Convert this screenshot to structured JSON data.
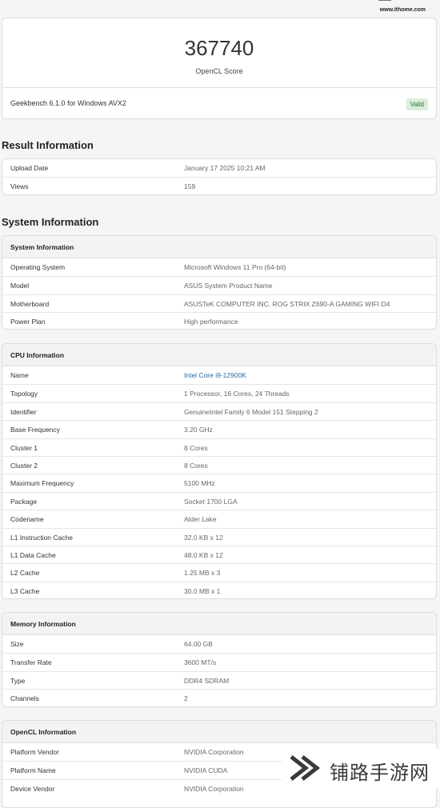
{
  "watermark": {
    "url": "www.ithome.com",
    "brand": "铺路手游网"
  },
  "score": {
    "value": "367740",
    "label": "OpenCL Score",
    "version": "Geekbench 6.1.0 for Windows AVX2",
    "badge": "Valid"
  },
  "result": {
    "title": "Result Information",
    "rows": [
      {
        "k": "Upload Date",
        "v": "January 17 2025 10:21 AM"
      },
      {
        "k": "Views",
        "v": "159"
      }
    ]
  },
  "system": {
    "title": "System Information",
    "sys_header": "System Information",
    "sys_rows": [
      {
        "k": "Operating System",
        "v": "Microsoft Windows 11 Pro (64-bit)"
      },
      {
        "k": "Model",
        "v": "ASUS System Product Name"
      },
      {
        "k": "Motherboard",
        "v": "ASUSTeK COMPUTER INC. ROG STRIX Z690-A GAMING WIFI D4"
      },
      {
        "k": "Power Plan",
        "v": "High performance"
      }
    ],
    "cpu_header": "CPU Information",
    "cpu_rows": [
      {
        "k": "Name",
        "v": "Intel Core i9-12900K"
      },
      {
        "k": "Topology",
        "v": "1 Processor, 16 Cores, 24 Threads"
      },
      {
        "k": "Identifier",
        "v": "GenuineIntel Family 6 Model 151 Stepping 2"
      },
      {
        "k": "Base Frequency",
        "v": "3.20 GHz"
      },
      {
        "k": "Cluster 1",
        "v": "8 Cores"
      },
      {
        "k": "Cluster 2",
        "v": "8 Cores"
      },
      {
        "k": "Maximum Frequency",
        "v": "5100 MHz"
      },
      {
        "k": "Package",
        "v": "Socket 1700 LGA"
      },
      {
        "k": "Codename",
        "v": "Alder Lake"
      },
      {
        "k": "L1 Instruction Cache",
        "v": "32.0 KB x 12"
      },
      {
        "k": "L1 Data Cache",
        "v": "48.0 KB x 12"
      },
      {
        "k": "L2 Cache",
        "v": "1.25 MB x 3"
      },
      {
        "k": "L3 Cache",
        "v": "30.0 MB x 1"
      }
    ],
    "mem_header": "Memory Information",
    "mem_rows": [
      {
        "k": "Size",
        "v": "64.00 GB"
      },
      {
        "k": "Transfer Rate",
        "v": "3600 MT/s"
      },
      {
        "k": "Type",
        "v": "DDR4 SDRAM"
      },
      {
        "k": "Channels",
        "v": "2"
      }
    ],
    "ocl_header": "OpenCL Information",
    "ocl_rows": [
      {
        "k": "Platform Vendor",
        "v": "NVIDIA Corporation"
      },
      {
        "k": "Platform Name",
        "v": "NVIDIA CUDA"
      },
      {
        "k": "Device Vendor",
        "v": "NVIDIA Corporation"
      }
    ]
  }
}
